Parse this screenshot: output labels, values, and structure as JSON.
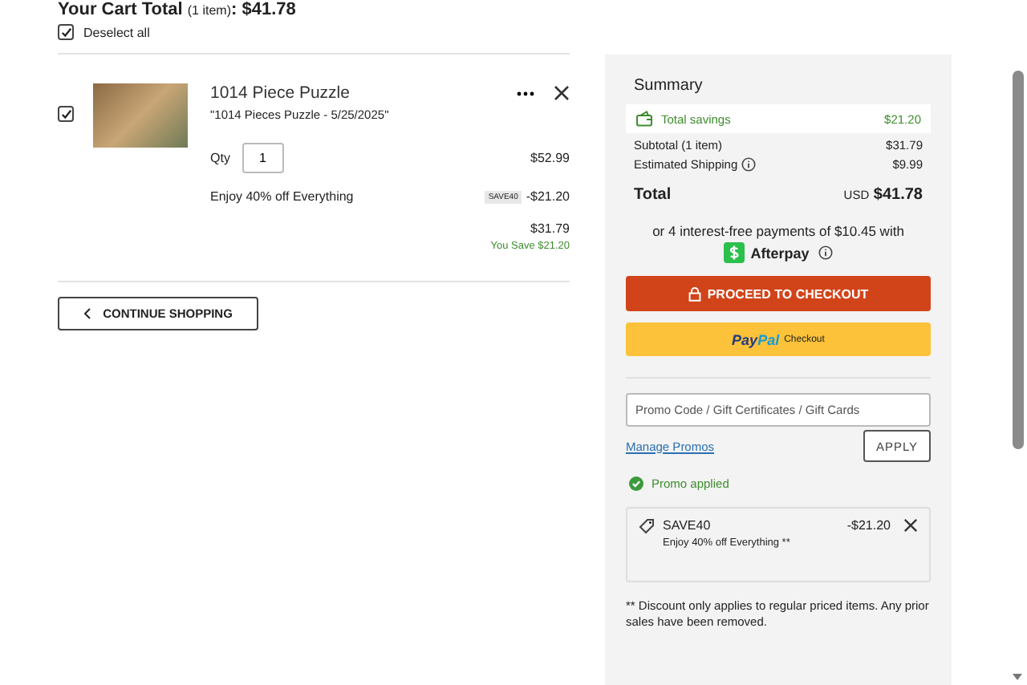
{
  "cart_header": {
    "title": "Your Cart Total",
    "count": "(1 item)",
    "total": ": $41.78"
  },
  "deselect_all": {
    "label": "Deselect all",
    "checked": true
  },
  "items": [
    {
      "checked": true,
      "name": "1014 Piece Puzzle",
      "variant": "\"1014 Pieces Puzzle - 5/25/2025\"",
      "qty_label": "Qty",
      "qty": "1",
      "price": "$52.99",
      "promo_text": "Enjoy 40% off Everything",
      "promo_code": "SAVE40",
      "discount": "-$21.20",
      "final_price": "$31.79",
      "you_save": "You Save $21.20"
    }
  ],
  "continue_button": "CONTINUE SHOPPING",
  "summary": {
    "title": "Summary",
    "savings_label": "Total savings",
    "savings_value": "$21.20",
    "rows": [
      {
        "label": "Subtotal",
        "note": "(1 item)",
        "value": "$31.79",
        "info": false
      },
      {
        "label": "Estimated Shipping",
        "note": "",
        "value": "$9.99",
        "info": true
      }
    ],
    "total_label": "Total",
    "total_currency": "USD",
    "total_value": "$41.78",
    "installments_text": "or 4 interest-free payments of $10.45 with",
    "afterpay_label": "Afterpay",
    "checkout_button": "PROCEED TO CHECKOUT",
    "paypal": {
      "brand_first": "Pay",
      "brand_second": "Pal",
      "label": "Checkout"
    },
    "promo_placeholder": "Promo Code / Gift Certificates / Gift Cards",
    "manage_promos": "Manage Promos",
    "apply_button": "APPLY",
    "promo_status": "Promo applied",
    "applied_promos": [
      {
        "code": "SAVE40",
        "description": "Enjoy 40% off Everything **",
        "amount": "-$21.20"
      }
    ],
    "disclaimer": "** Discount only applies to regular priced items. Any prior sales have been removed."
  }
}
